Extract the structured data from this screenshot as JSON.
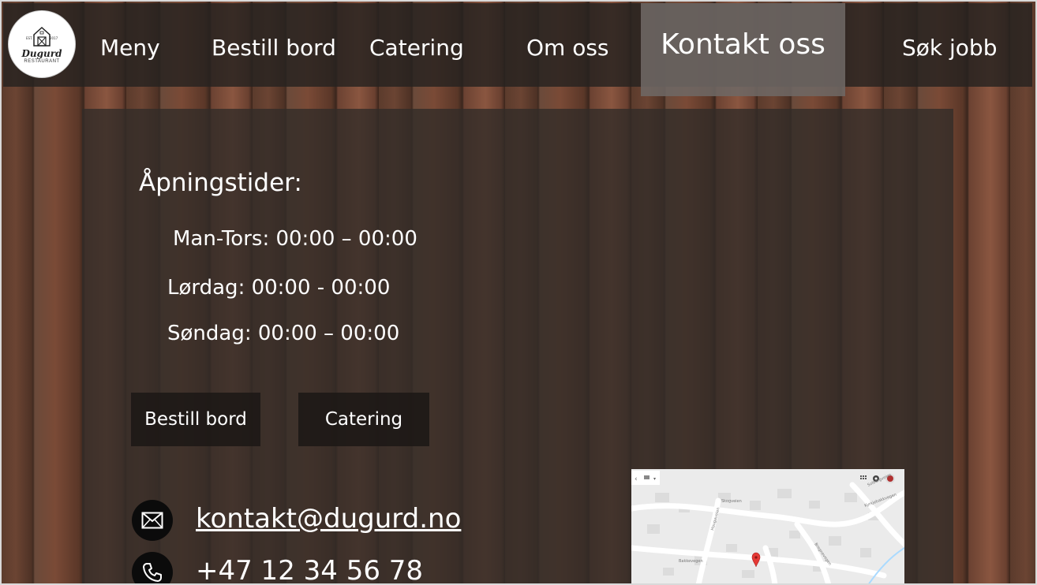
{
  "logo": {
    "name": "Dugurd",
    "subtitle": "RESTAURANT",
    "est_left": "EST.",
    "est_right": "2017"
  },
  "nav": {
    "items": [
      {
        "label": "Meny"
      },
      {
        "label": "Bestill bord"
      },
      {
        "label": "Catering"
      },
      {
        "label": "Om oss"
      },
      {
        "label": "Kontakt oss"
      },
      {
        "label": "Søk jobb"
      }
    ],
    "active_index": 4
  },
  "hours": {
    "title": "Åpningstider:",
    "lines": [
      {
        "text": "Man-Tors: 00:00 – 00:00"
      },
      {
        "text": "Lørdag: 00:00 - 00:00"
      },
      {
        "text": "Søndag: 00:00 – 00:00"
      }
    ]
  },
  "buttons": {
    "book_label": "Bestill bord",
    "catering_label": "Catering"
  },
  "contact": {
    "email": "kontakt@dugurd.no",
    "phone": "+47 12 34 56 78",
    "email_icon": "envelope-icon",
    "phone_icon": "phone-icon"
  },
  "map": {
    "pin_icon": "map-pin-icon",
    "street_labels": [
      "Skogveien",
      "Solbergveien",
      "Kyrkjebakkvegen",
      "Haugaveien",
      "Bakkevegen",
      "Bregnevegen"
    ]
  },
  "colors": {
    "nav_bg": "#262220",
    "active_tab_bg": "#6e6864",
    "panel_bg": "#322c28",
    "button_bg": "#1c1816",
    "map_pin": "#e53935"
  }
}
